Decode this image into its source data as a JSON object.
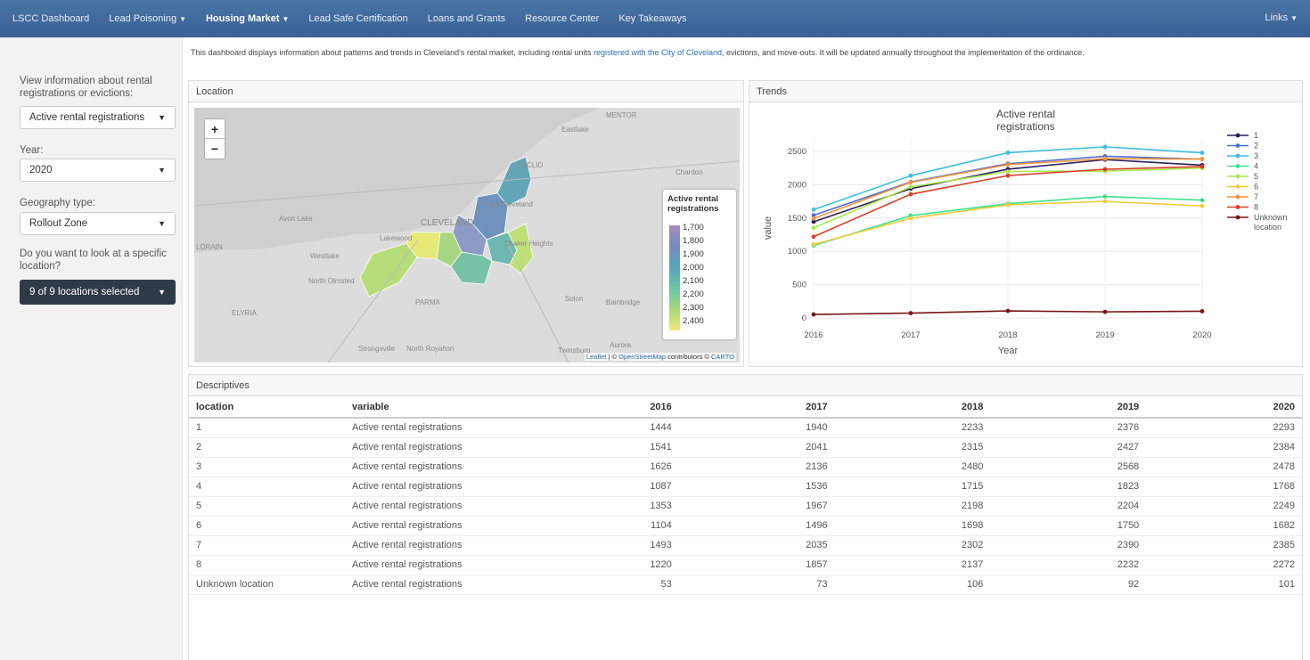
{
  "nav": {
    "brand": "LSCC Dashboard",
    "items": [
      {
        "label": "Lead Poisoning",
        "dropdown": true,
        "active": false
      },
      {
        "label": "Housing Market",
        "dropdown": true,
        "active": true
      },
      {
        "label": "Lead Safe Certification",
        "dropdown": false,
        "active": false
      },
      {
        "label": "Loans and Grants",
        "dropdown": false,
        "active": false
      },
      {
        "label": "Resource Center",
        "dropdown": false,
        "active": false
      },
      {
        "label": "Key Takeaways",
        "dropdown": false,
        "active": false
      }
    ],
    "right_label": "Links"
  },
  "sidebar": {
    "view_label": "View information about rental registrations or evictions:",
    "view_value": "Active rental registrations",
    "year_label": "Year:",
    "year_value": "2020",
    "geo_label": "Geography type:",
    "geo_value": "Rollout Zone",
    "location_label": "Do you want to look at a specific location?",
    "location_value": "9 of 9 locations selected"
  },
  "intro": {
    "before": "This dashboard displays information about patterns and trends in Cleveland's rental market, including rental units ",
    "link": "registered with the City of Cleveland",
    "after": ", evictions, and move-outs. It will be updated annually throughout the implementation of the ordinance."
  },
  "map": {
    "panel_title": "Location",
    "zoom_in": "+",
    "zoom_out": "−",
    "legend_title": "Active rental registrations",
    "legend_ticks": [
      "1,700",
      "1,800",
      "1,900",
      "2,000",
      "2,100",
      "2,200",
      "2,300",
      "2,400"
    ],
    "place_labels": [
      "MENTOR",
      "Eastlake",
      "EUCLID",
      "Chardon",
      "East Cleveland",
      "Avon Lake",
      "CLEVELAND",
      "Lakewood",
      "Shaker Heights",
      "LORAIN",
      "Westlake",
      "North Olmsted",
      "PARMA",
      "Solon",
      "Bainbridge",
      "ELYRIA",
      "Strongsville",
      "North Royalton",
      "Twinsburg",
      "Aurora"
    ],
    "attribution_leaflet": "Leaflet",
    "attribution_mid": " | © ",
    "attribution_osm": "OpenStreetMap",
    "attribution_contrib": " contributors © ",
    "attribution_carto": "CARTO"
  },
  "trends": {
    "panel_title": "Trends",
    "chart_data": {
      "type": "line",
      "title": "Active rental registrations",
      "xlabel": "Year",
      "ylabel": "value",
      "x": [
        2016,
        2017,
        2018,
        2019,
        2020
      ],
      "ylim": [
        0,
        2700
      ],
      "yticks": [
        0,
        500,
        1000,
        1500,
        2000,
        2500
      ],
      "grid": true,
      "legend_position": "right",
      "series": [
        {
          "name": "1",
          "color": "#2c1e5a",
          "values": [
            1444,
            1940,
            2233,
            2376,
            2293
          ]
        },
        {
          "name": "2",
          "color": "#4e6fd0",
          "values": [
            1541,
            2041,
            2315,
            2427,
            2384
          ]
        },
        {
          "name": "3",
          "color": "#3fbde0",
          "values": [
            1626,
            2136,
            2480,
            2568,
            2478
          ]
        },
        {
          "name": "4",
          "color": "#3de08c",
          "values": [
            1087,
            1536,
            1715,
            1823,
            1768
          ]
        },
        {
          "name": "5",
          "color": "#a8e84a",
          "values": [
            1353,
            1967,
            2198,
            2204,
            2249
          ]
        },
        {
          "name": "6",
          "color": "#f2cc3c",
          "values": [
            1104,
            1496,
            1698,
            1750,
            1682
          ]
        },
        {
          "name": "7",
          "color": "#f5943a",
          "values": [
            1493,
            2035,
            2302,
            2390,
            2385
          ]
        },
        {
          "name": "8",
          "color": "#d8402a",
          "values": [
            1220,
            1857,
            2137,
            2232,
            2272
          ]
        },
        {
          "name": "Unknown location",
          "color": "#7a1414",
          "values": [
            53,
            73,
            106,
            92,
            101
          ]
        }
      ]
    }
  },
  "descriptives": {
    "panel_title": "Descriptives",
    "columns": [
      "location",
      "variable",
      "2016",
      "2017",
      "2018",
      "2019",
      "2020"
    ],
    "rows": [
      [
        "1",
        "Active rental registrations",
        "1444",
        "1940",
        "2233",
        "2376",
        "2293"
      ],
      [
        "2",
        "Active rental registrations",
        "1541",
        "2041",
        "2315",
        "2427",
        "2384"
      ],
      [
        "3",
        "Active rental registrations",
        "1626",
        "2136",
        "2480",
        "2568",
        "2478"
      ],
      [
        "4",
        "Active rental registrations",
        "1087",
        "1536",
        "1715",
        "1823",
        "1768"
      ],
      [
        "5",
        "Active rental registrations",
        "1353",
        "1967",
        "2198",
        "2204",
        "2249"
      ],
      [
        "6",
        "Active rental registrations",
        "1104",
        "1496",
        "1698",
        "1750",
        "1682"
      ],
      [
        "7",
        "Active rental registrations",
        "1493",
        "2035",
        "2302",
        "2390",
        "2385"
      ],
      [
        "8",
        "Active rental registrations",
        "1220",
        "1857",
        "2137",
        "2232",
        "2272"
      ],
      [
        "Unknown location",
        "Active rental registrations",
        "53",
        "73",
        "106",
        "92",
        "101"
      ]
    ]
  }
}
